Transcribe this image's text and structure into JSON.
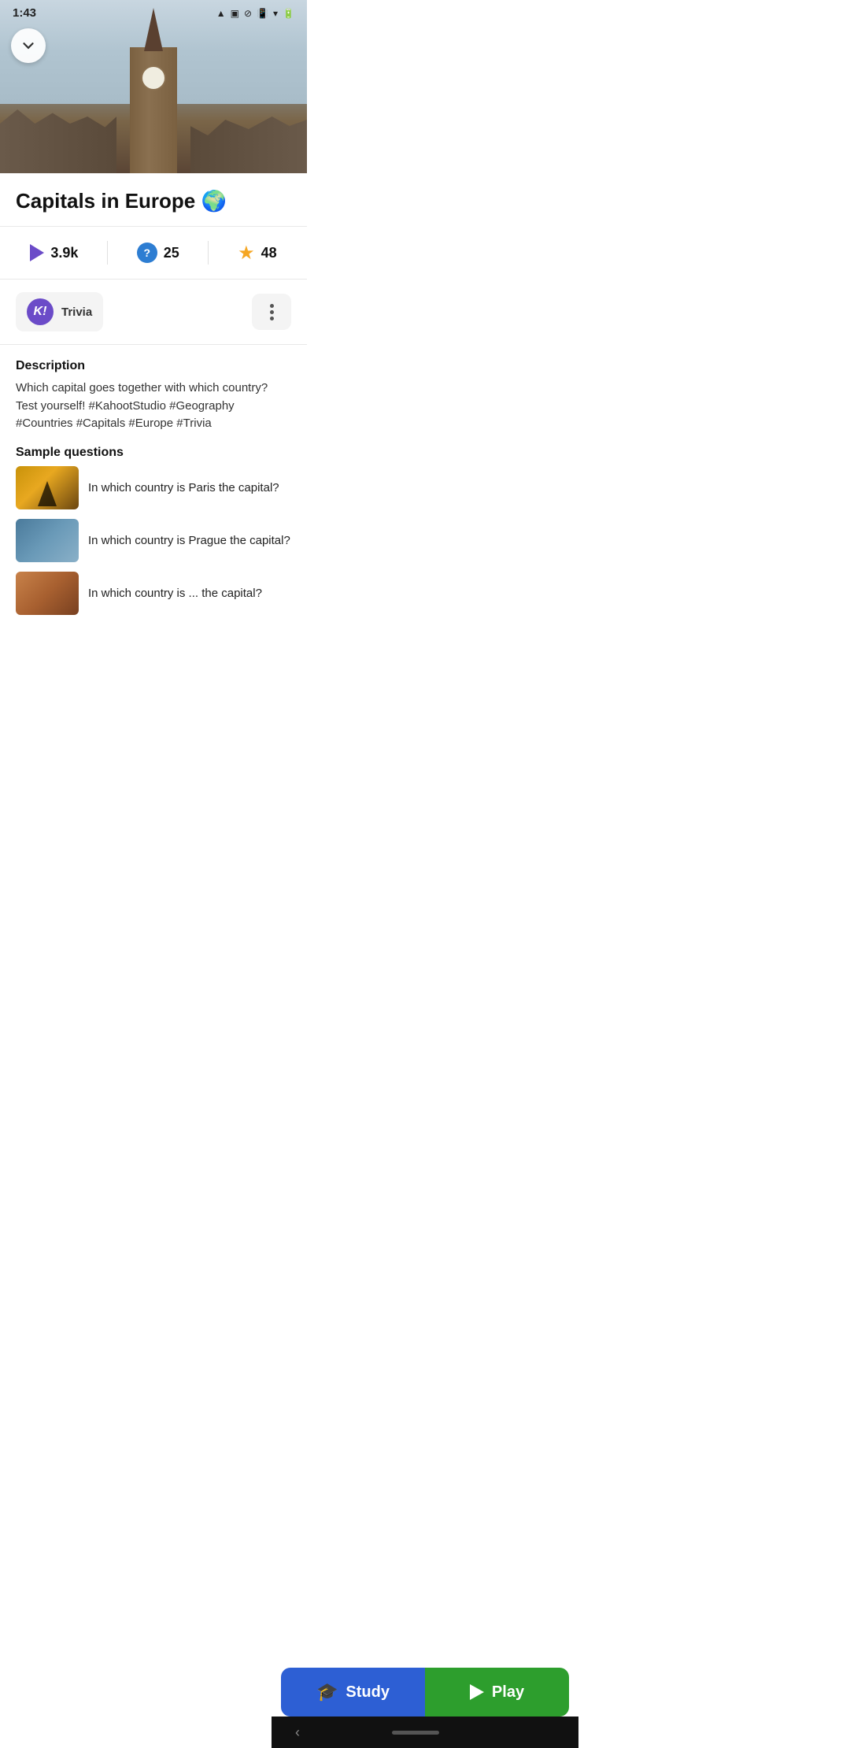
{
  "statusBar": {
    "time": "1:43",
    "icons": [
      "drive-icon",
      "clipboard-icon",
      "block-icon"
    ]
  },
  "header": {
    "backButton": "chevron-down"
  },
  "hero": {
    "imageDescription": "Big Ben tower in London with cloudy sky"
  },
  "quiz": {
    "title": "Capitals in Europe 🌍",
    "stats": {
      "plays": "3.9k",
      "questions": "25",
      "favorites": "48"
    },
    "creator": {
      "logo": "K!",
      "name": "Trivia"
    },
    "description": {
      "sectionTitle": "Description",
      "text": "Which capital goes together with which country? Test yourself! #KahootStudio #Geography #Countries #Capitals #Europe #Trivia"
    },
    "sampleQuestions": {
      "sectionTitle": "Sample questions",
      "items": [
        {
          "text": "In which country is Paris the capital?",
          "thumbType": "paris"
        },
        {
          "text": "In which country is Prague the capital?",
          "thumbType": "prague"
        },
        {
          "text": "In which country is ... the capital?",
          "thumbType": "generic"
        }
      ]
    }
  },
  "buttons": {
    "study": "Study",
    "play": "Play"
  },
  "nav": {
    "backArrow": "‹"
  }
}
